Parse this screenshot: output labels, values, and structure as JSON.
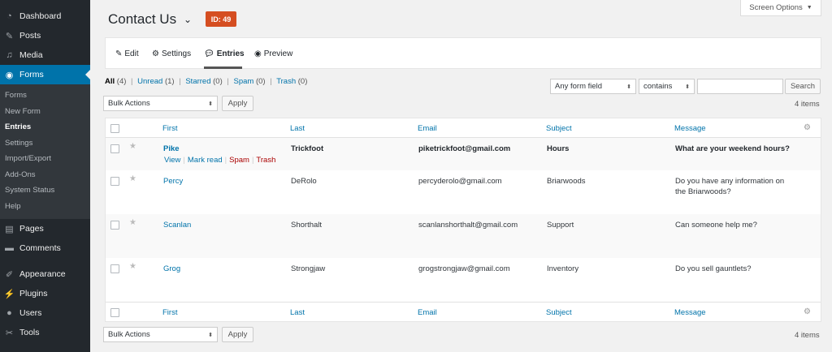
{
  "sidebar": {
    "top_items": [
      {
        "label": "Dashboard",
        "icon": "dashboard-icon"
      },
      {
        "label": "Posts",
        "icon": "pin-icon"
      },
      {
        "label": "Media",
        "icon": "media-icon"
      }
    ],
    "active_item": {
      "label": "Forms",
      "icon": "forms-icon"
    },
    "submenu": [
      "Forms",
      "New Form",
      "Entries",
      "Settings",
      "Import/Export",
      "Add-Ons",
      "System Status",
      "Help"
    ],
    "current_submenu": "Entries",
    "bottom_items": [
      {
        "label": "Pages",
        "icon": "pages-icon"
      },
      {
        "label": "Comments",
        "icon": "comments-icon"
      },
      {
        "label": "Appearance",
        "icon": "appearance-icon"
      },
      {
        "label": "Plugins",
        "icon": "plugins-icon"
      },
      {
        "label": "Users",
        "icon": "users-icon"
      },
      {
        "label": "Tools",
        "icon": "tools-icon"
      }
    ],
    "colors": {
      "background": "#23282d",
      "active": "#0073aa"
    }
  },
  "header": {
    "title": "Contact Us",
    "id_badge": "ID: 49",
    "badge_color": "#d54e21",
    "screen_options": "Screen Options"
  },
  "toolbar": {
    "edit": "Edit",
    "settings": "Settings",
    "entries": "Entries",
    "preview": "Preview"
  },
  "filters": {
    "all": "All",
    "all_count": "(4)",
    "unread": "Unread",
    "unread_count": "(1)",
    "starred": "Starred",
    "starred_count": "(0)",
    "spam": "Spam",
    "spam_count": "(0)",
    "trash": "Trash",
    "trash_count": "(0)",
    "separator": "|"
  },
  "search": {
    "field_select": "Any form field",
    "operator_select": "contains",
    "value": "",
    "button": "Search"
  },
  "bulk": {
    "top_select": "Bulk Actions",
    "top_apply": "Apply",
    "bottom_select": "Bulk Actions",
    "bottom_apply": "Apply",
    "items_top": "4 items",
    "items_bottom": "4 items"
  },
  "table": {
    "columns": [
      "First",
      "Last",
      "Email",
      "Subject",
      "Message"
    ],
    "footer_columns": [
      "First",
      "Last",
      "Email",
      "Subject",
      "Message"
    ],
    "rows": [
      {
        "first": "Pike",
        "last": "Trickfoot",
        "email": "piketrickfoot@gmail.com",
        "subject": "Hours",
        "message": "What are your weekend hours?",
        "unread": true
      },
      {
        "first": "Percy",
        "last": "DeRolo",
        "email": "percyderolo@gmail.com",
        "subject": "Briarwoods",
        "message_line1": "Do you have any information on",
        "message_line2": "the Briarwoods?",
        "unread": false
      },
      {
        "first": "Scanlan",
        "last": "Shorthalt",
        "email": "scanlanshorthalt@gmail.com",
        "subject": "Support",
        "message": "Can someone help me?",
        "unread": false
      },
      {
        "first": "Grog",
        "last": "Strongjaw",
        "email": "grogstrongjaw@gmail.com",
        "subject": "Inventory",
        "message": "Do you sell gauntlets?",
        "unread": false
      }
    ],
    "row_actions": {
      "view": "View",
      "mark_read": "Mark read",
      "spam": "Spam",
      "trash": "Trash",
      "separator": "|"
    }
  }
}
